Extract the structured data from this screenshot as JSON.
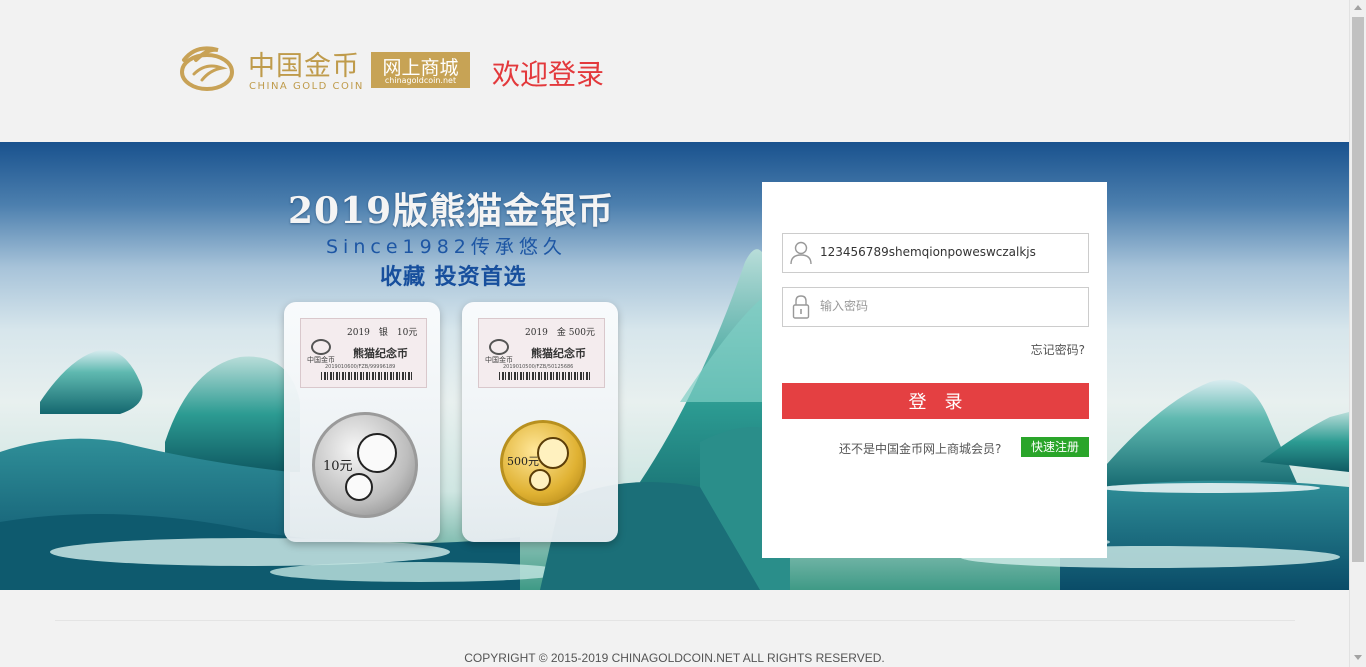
{
  "header": {
    "logo_cn": "中国金币",
    "logo_en": "CHINA GOLD COIN",
    "mall_label": "网上商城",
    "mall_domain": "chinagoldcoin.net",
    "welcome": "欢迎登录"
  },
  "banner": {
    "title": "2019版熊猫金银币",
    "since": "Since1982传承悠久",
    "slogan": "收藏 投资首选",
    "silver_coin": {
      "label_year": "2019　银　10元",
      "label_brand": "中国金币",
      "label_name": "熊猫纪念币",
      "label_code": "2019010600/FZB/99996189",
      "denomination": "10元"
    },
    "gold_coin": {
      "label_year": "2019　金 500元",
      "label_brand": "中国金币",
      "label_name": "熊猫纪念币",
      "label_code": "2019010500/FZB/50125686",
      "denomination": "500元"
    }
  },
  "login": {
    "username_value": "123456789shemqionpoweswczalkjs",
    "password_placeholder": "输入密码",
    "forgot_password": "忘记密码?",
    "login_button": "登录",
    "not_member_text": "还不是中国金币网上商城会员?",
    "register_button": "快速注册"
  },
  "footer": {
    "copyright": "COPYRIGHT © 2015-2019 CHINAGOLDCOIN.NET ALL RIGHTS RESERVED."
  },
  "colors": {
    "brand_gold": "#bf9b4b",
    "welcome_red": "#e3393c",
    "login_button_red": "#e44042",
    "register_green": "#2aa52a"
  },
  "icons": {
    "logo_mark": "gold-ring-logo-icon",
    "username": "user-icon",
    "password": "lock-icon"
  }
}
